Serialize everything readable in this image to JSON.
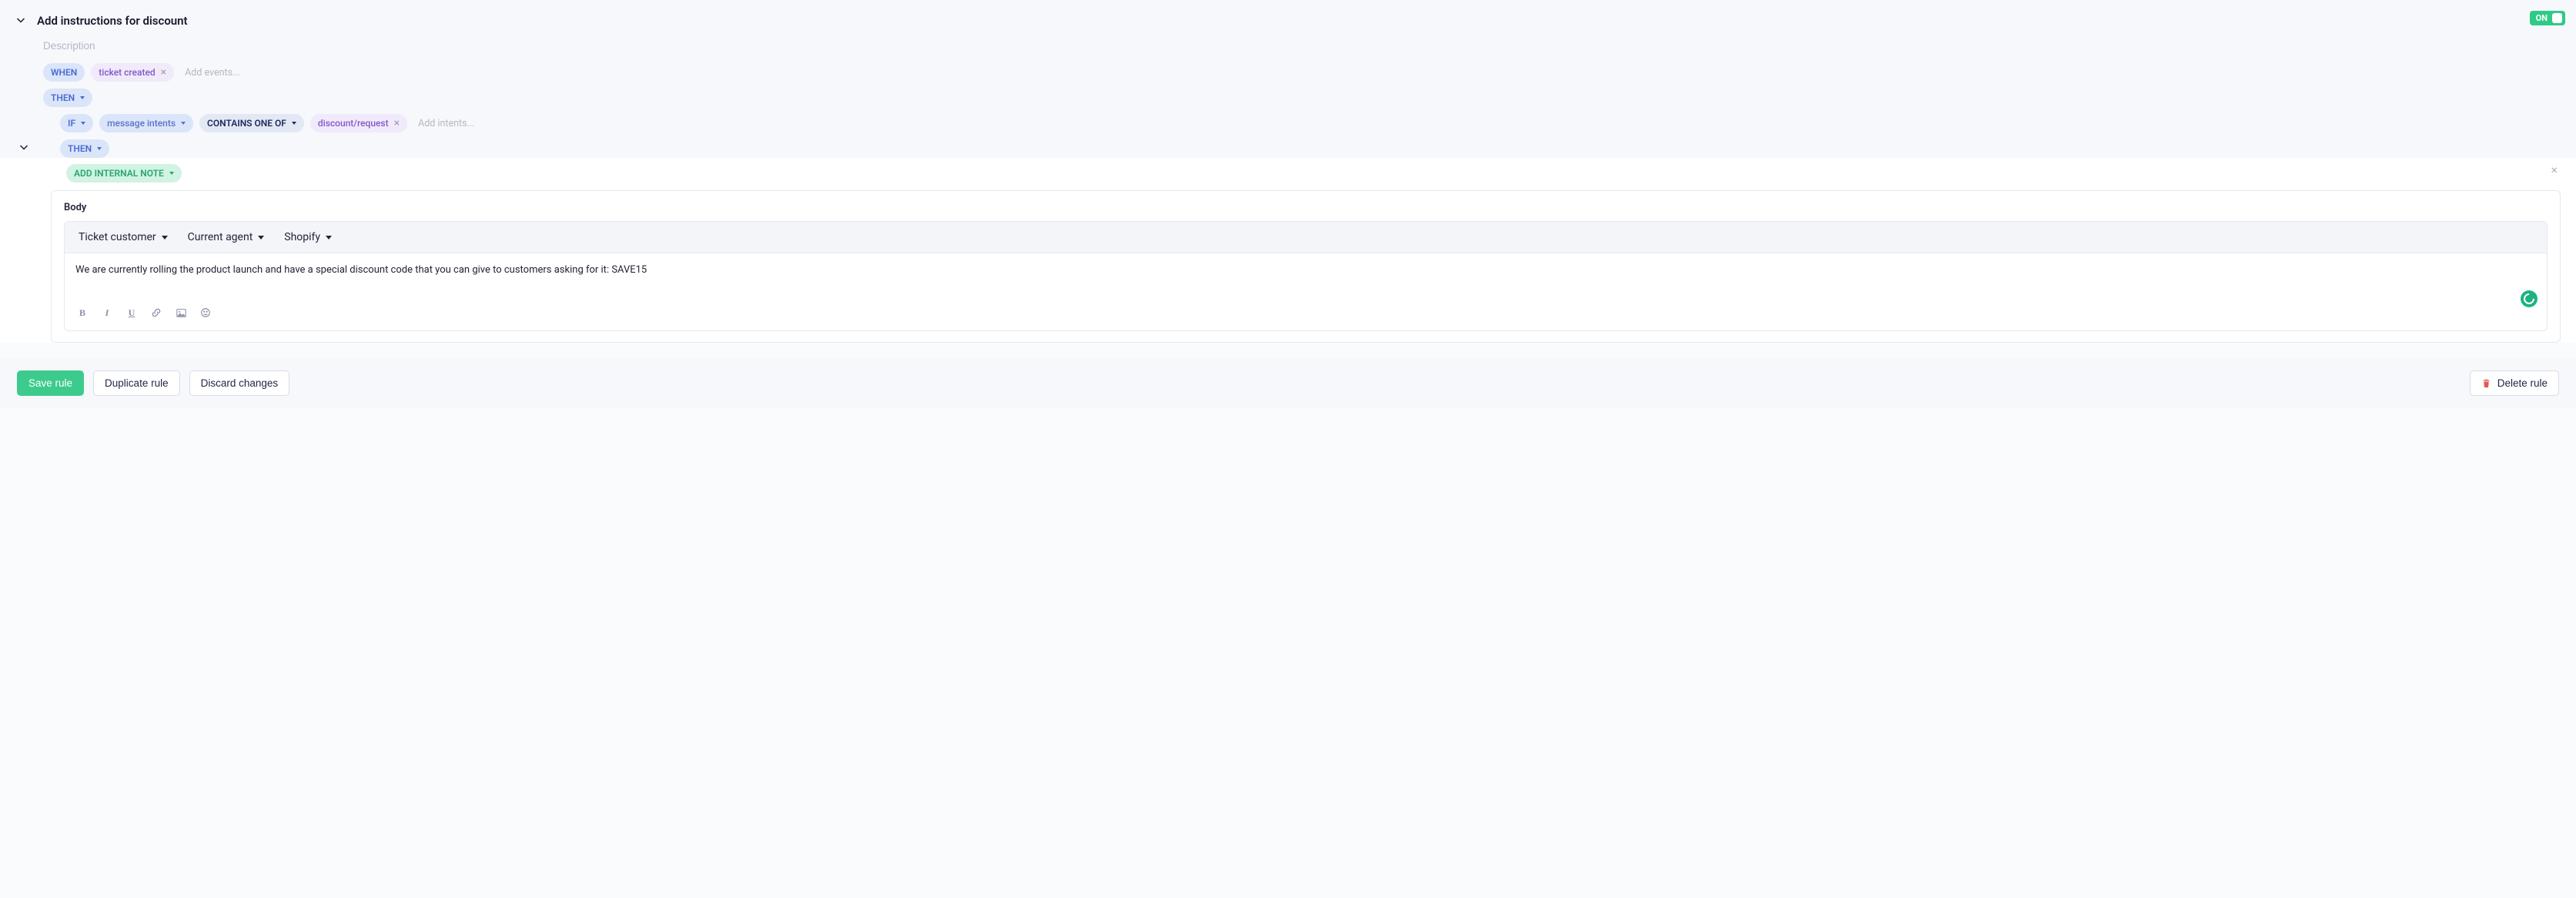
{
  "header": {
    "title": "Add instructions for discount",
    "description_placeholder": "Description",
    "toggle_label": "ON"
  },
  "rule": {
    "when_label": "WHEN",
    "when_event": "ticket created",
    "add_events_placeholder": "Add events...",
    "then_label": "THEN",
    "if_label": "IF",
    "condition_field": "message intents",
    "condition_operator": "CONTAINS ONE OF",
    "condition_value": "discount/request",
    "add_intents_placeholder": "Add intents...",
    "action_label": "ADD INTERNAL NOTE"
  },
  "editor": {
    "body_label": "Body",
    "toolbar_items": [
      "Ticket customer",
      "Current agent",
      "Shopify"
    ],
    "content": "We are currently rolling the product launch and have a special discount code that you can give to customers asking for it: SAVE15"
  },
  "footer": {
    "save": "Save rule",
    "duplicate": "Duplicate rule",
    "discard": "Discard changes",
    "delete": "Delete rule"
  }
}
